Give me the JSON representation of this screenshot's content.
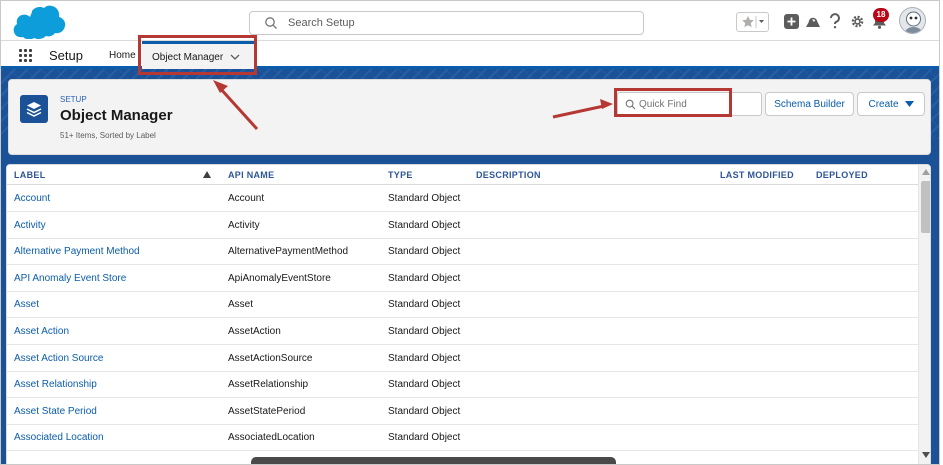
{
  "header": {
    "search_placeholder": "Search Setup",
    "notification_count": "18"
  },
  "nav": {
    "app_name": "Setup",
    "home_label": "Home",
    "active_tab": "Object Manager"
  },
  "page": {
    "eyebrow": "SETUP",
    "title": "Object Manager",
    "meta": "51+ Items, Sorted by Label",
    "quick_find_placeholder": "Quick Find",
    "schema_builder_label": "Schema Builder",
    "create_label": "Create"
  },
  "table": {
    "columns": [
      "LABEL",
      "API NAME",
      "TYPE",
      "DESCRIPTION",
      "LAST MODIFIED",
      "DEPLOYED"
    ],
    "rows": [
      {
        "label": "Account",
        "api": "Account",
        "type": "Standard Object"
      },
      {
        "label": "Activity",
        "api": "Activity",
        "type": "Standard Object"
      },
      {
        "label": "Alternative Payment Method",
        "api": "AlternativePaymentMethod",
        "type": "Standard Object"
      },
      {
        "label": "API Anomaly Event Store",
        "api": "ApiAnomalyEventStore",
        "type": "Standard Object"
      },
      {
        "label": "Asset",
        "api": "Asset",
        "type": "Standard Object"
      },
      {
        "label": "Asset Action",
        "api": "AssetAction",
        "type": "Standard Object"
      },
      {
        "label": "Asset Action Source",
        "api": "AssetActionSource",
        "type": "Standard Object"
      },
      {
        "label": "Asset Relationship",
        "api": "AssetRelationship",
        "type": "Standard Object"
      },
      {
        "label": "Asset State Period",
        "api": "AssetStatePeriod",
        "type": "Standard Object"
      },
      {
        "label": "Associated Location",
        "api": "AssociatedLocation",
        "type": "Standard Object"
      }
    ]
  },
  "colors": {
    "brand": "#1b5297",
    "link": "#0b5cab",
    "callout": "#b53834"
  },
  "icons": [
    "salesforce-cloud-logo",
    "search-icon",
    "favorites-star-icon",
    "add-icon",
    "trailhead-icon",
    "help-icon",
    "gear-icon",
    "bell-icon",
    "layers-icon",
    "chevron-down-icon"
  ]
}
